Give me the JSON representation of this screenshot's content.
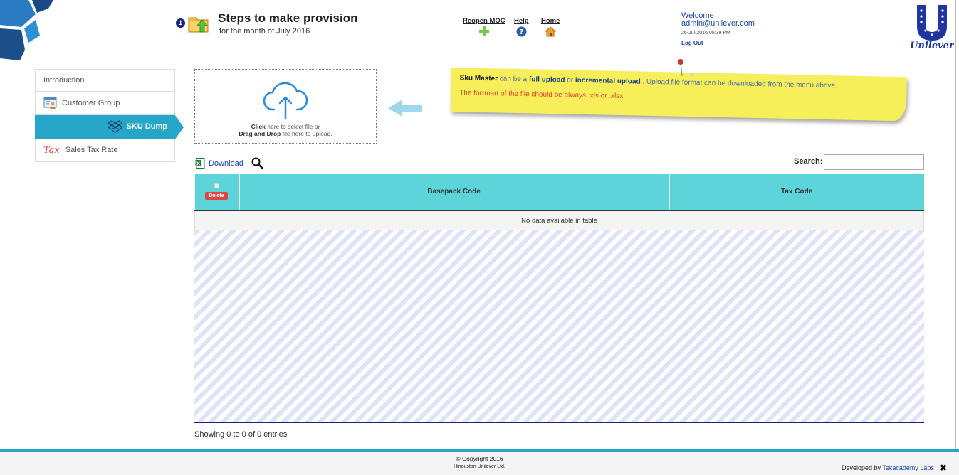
{
  "header": {
    "step_number": "1",
    "title": "Steps to make provision",
    "subtitle": "for the month of July 2016",
    "links": {
      "reopen_moc": "Reopen MOC",
      "help": "Help",
      "home": "Home"
    },
    "user": {
      "welcome": "Welcome",
      "email": "admin@unilever.com",
      "datetime": "26-Jul-2016 05:39 PM",
      "logout": "Log Out"
    },
    "logo_text": "Unilever"
  },
  "sidebar": {
    "items": [
      {
        "label": "Introduction",
        "icon": "none"
      },
      {
        "label": "Customer Group",
        "icon": "customer-group-icon"
      },
      {
        "label": "SKU Dump",
        "icon": "dropbox-icon",
        "active": true
      },
      {
        "label": "Sales Tax Rate",
        "icon": "tax-icon",
        "icon_text": "Tax"
      }
    ]
  },
  "upload": {
    "click_bold": "Click",
    "click_rest": " here to select file or",
    "drag_bold": "Drag and Drop",
    "drag_rest": " file here to upload."
  },
  "note": {
    "lead": "Sku Master",
    "t1": " can be a ",
    "full": "full upload",
    "t2": " or ",
    "incremental": "incremental upload",
    "t3": ".. Upload file format can be downloaded from the menu above.",
    "format_line": "The forrmart of the file should be always .xls or .xlsx"
  },
  "table": {
    "download_label": "Download",
    "search_label": "Search:",
    "search_value": "",
    "delete_label": "Delete",
    "columns": [
      "Basepack Code",
      "Tax Code"
    ],
    "empty_message": "No data available in table",
    "info": "Showing 0 to 0 of 0 entries"
  },
  "footer": {
    "copyright": "Copyright 2016",
    "org": "Hindustan Unilever Ltd.",
    "developed_by": "Developed by",
    "developer": "Tekacademy Labs",
    "close": "✖"
  },
  "colors": {
    "accent": "#25a5c7",
    "table_header": "#5cd4d9",
    "note": "#f7ef5a",
    "delete": "#e04545"
  }
}
